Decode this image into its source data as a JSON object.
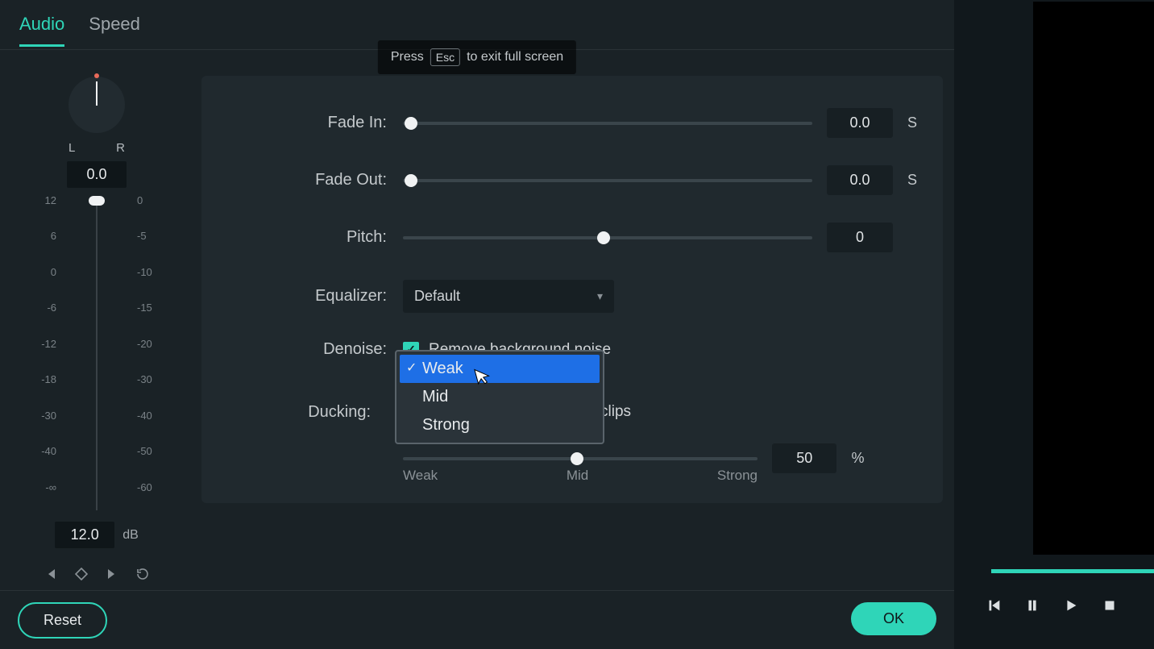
{
  "tabs": {
    "audio": "Audio",
    "speed": "Speed"
  },
  "hint": {
    "press": "Press",
    "esc": "Esc",
    "tail": "to exit full screen"
  },
  "meter": {
    "left_label": "L",
    "right_label": "R",
    "pan_value": "0.0",
    "gain_value": "12.0",
    "gain_unit": "dB",
    "left_ticks": [
      "12",
      "6",
      "0",
      "-6",
      "-12",
      "-18",
      "-30",
      "-40",
      "-∞"
    ],
    "right_ticks": [
      "0",
      "-5",
      "-10",
      "-15",
      "-20",
      "-30",
      "-40",
      "-50",
      "-60"
    ]
  },
  "settings": {
    "fade_in": {
      "label": "Fade In:",
      "value": "0.0",
      "unit": "S",
      "pos_pct": 0
    },
    "fade_out": {
      "label": "Fade Out:",
      "value": "0.0",
      "unit": "S",
      "pos_pct": 0
    },
    "pitch": {
      "label": "Pitch:",
      "value": "0",
      "pos_pct": 49
    },
    "equalizer": {
      "label": "Equalizer:",
      "value": "Default"
    },
    "denoise": {
      "label": "Denoise:",
      "check_label": "Remove background noise",
      "checked": true
    },
    "denoise_options": [
      "Weak",
      "Mid",
      "Strong"
    ],
    "denoise_selected": "Weak",
    "ducking": {
      "label": "Ducking:",
      "tail_text": "clips",
      "value": "50",
      "unit": "%",
      "pos_pct": 49,
      "ticks": [
        "Weak",
        "Mid",
        "Strong"
      ]
    }
  },
  "footer": {
    "reset": "Reset",
    "ok": "OK"
  }
}
